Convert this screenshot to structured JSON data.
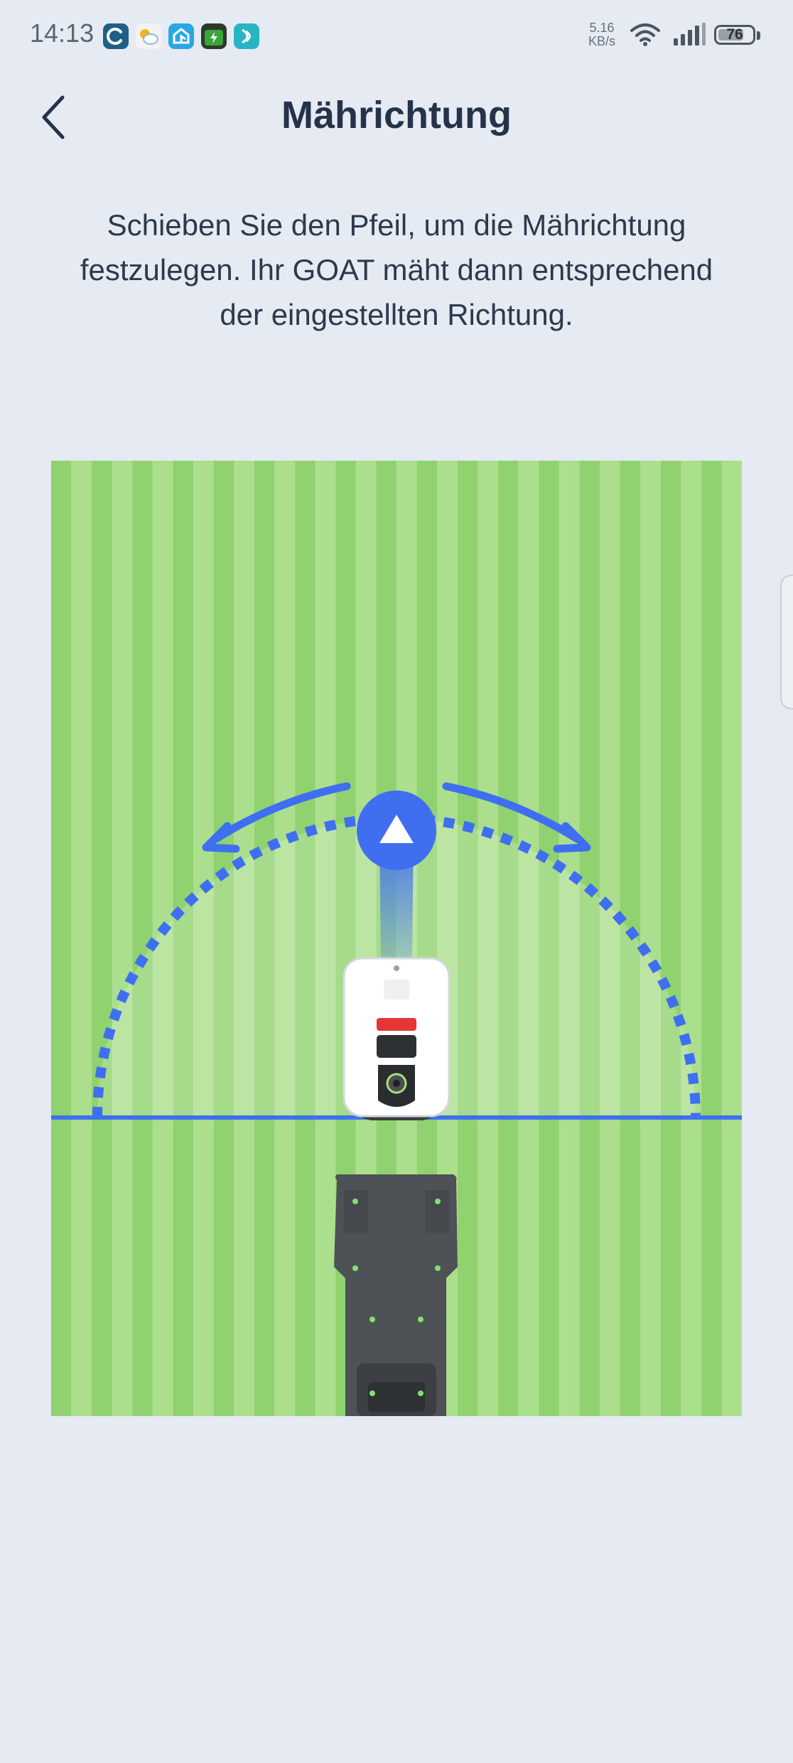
{
  "status_bar": {
    "time": "14:13",
    "speed_value": "5.16",
    "speed_unit": "KB/s",
    "battery": "76",
    "battery_level": 0.76,
    "app_icons": [
      {
        "name": "app-icon-c",
        "color": "#1f5f86"
      },
      {
        "name": "app-icon-weather",
        "color": "#f3f3f3"
      },
      {
        "name": "app-icon-home",
        "color": "#29a7e1"
      },
      {
        "name": "app-icon-battery",
        "color": "#3aa63a"
      },
      {
        "name": "app-icon-swirl",
        "color": "#27b5c4"
      }
    ]
  },
  "header": {
    "back_icon": "chevron-left-icon",
    "title": "Mährichtung"
  },
  "instruction": "Schieben Sie den Pfeil, um die Mährichtung festzulegen. Ihr GOAT mäht dann entsprechend der eingestellten Richtung.",
  "colors": {
    "background": "#e6eaf2",
    "lawn_light": "#acdf8d",
    "lawn_dark": "#8fd26f",
    "accent_blue": "#3f6ff0",
    "title": "#25334a"
  },
  "direction_control": {
    "handle_icon": "triangle-up-icon",
    "left_arrow_icon": "curved-arrow-left-icon",
    "right_arrow_icon": "curved-arrow-right-icon",
    "angle_deg": 0
  },
  "illustration": {
    "mower": "robot-mower",
    "station": "charging-station"
  }
}
